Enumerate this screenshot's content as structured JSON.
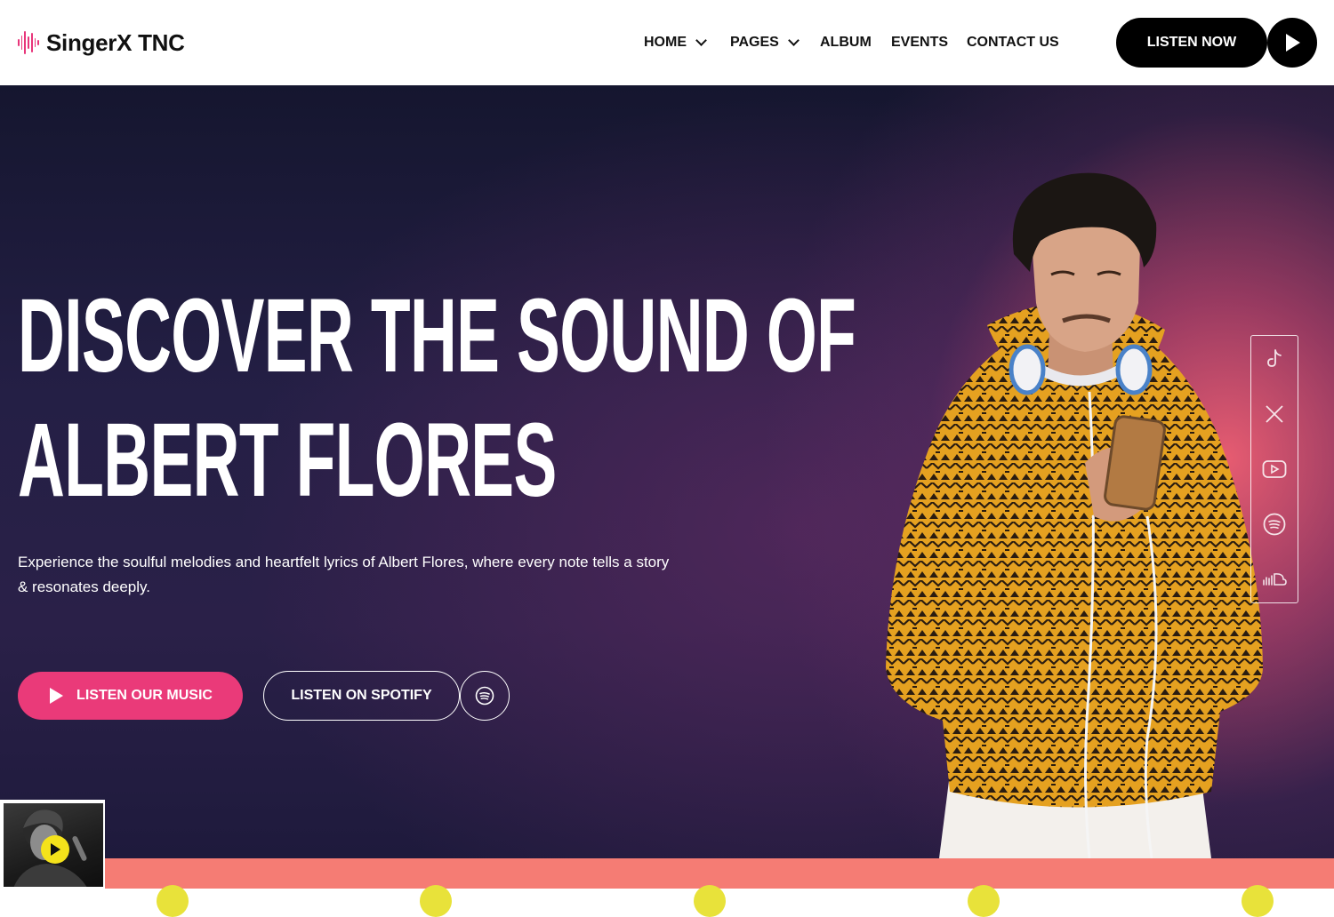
{
  "header": {
    "logo_text": "SingerX TNC",
    "nav": [
      {
        "label": "HOME",
        "has_dropdown": true
      },
      {
        "label": "PAGES",
        "has_dropdown": true
      },
      {
        "label": "ALBUM",
        "has_dropdown": false
      },
      {
        "label": "EVENTS",
        "has_dropdown": false
      },
      {
        "label": "CONTACT US",
        "has_dropdown": false
      }
    ],
    "listen_now_label": "LISTEN NOW",
    "play_icon": "play-icon"
  },
  "hero": {
    "title_line1": "DISCOVER THE SOUND OF",
    "title_line2": "ALBERT FLORES",
    "subtitle": "Experience the soulful melodies and heartfelt lyrics of Albert Flores, where every note tells a story & resonates deeply.",
    "listen_music_label": "LISTEN OUR MUSIC",
    "listen_spotify_label": "LISTEN ON SPOTIFY"
  },
  "social": [
    "tiktok-icon",
    "x-icon",
    "youtube-icon",
    "spotify-icon",
    "soundcloud-icon"
  ],
  "colors": {
    "accent_pink": "#ea3a79",
    "brand_black": "#000000",
    "strip_coral": "#f57c74",
    "mini_play_yellow": "#f4e21b",
    "hero_dark": "#1e1a3c"
  }
}
